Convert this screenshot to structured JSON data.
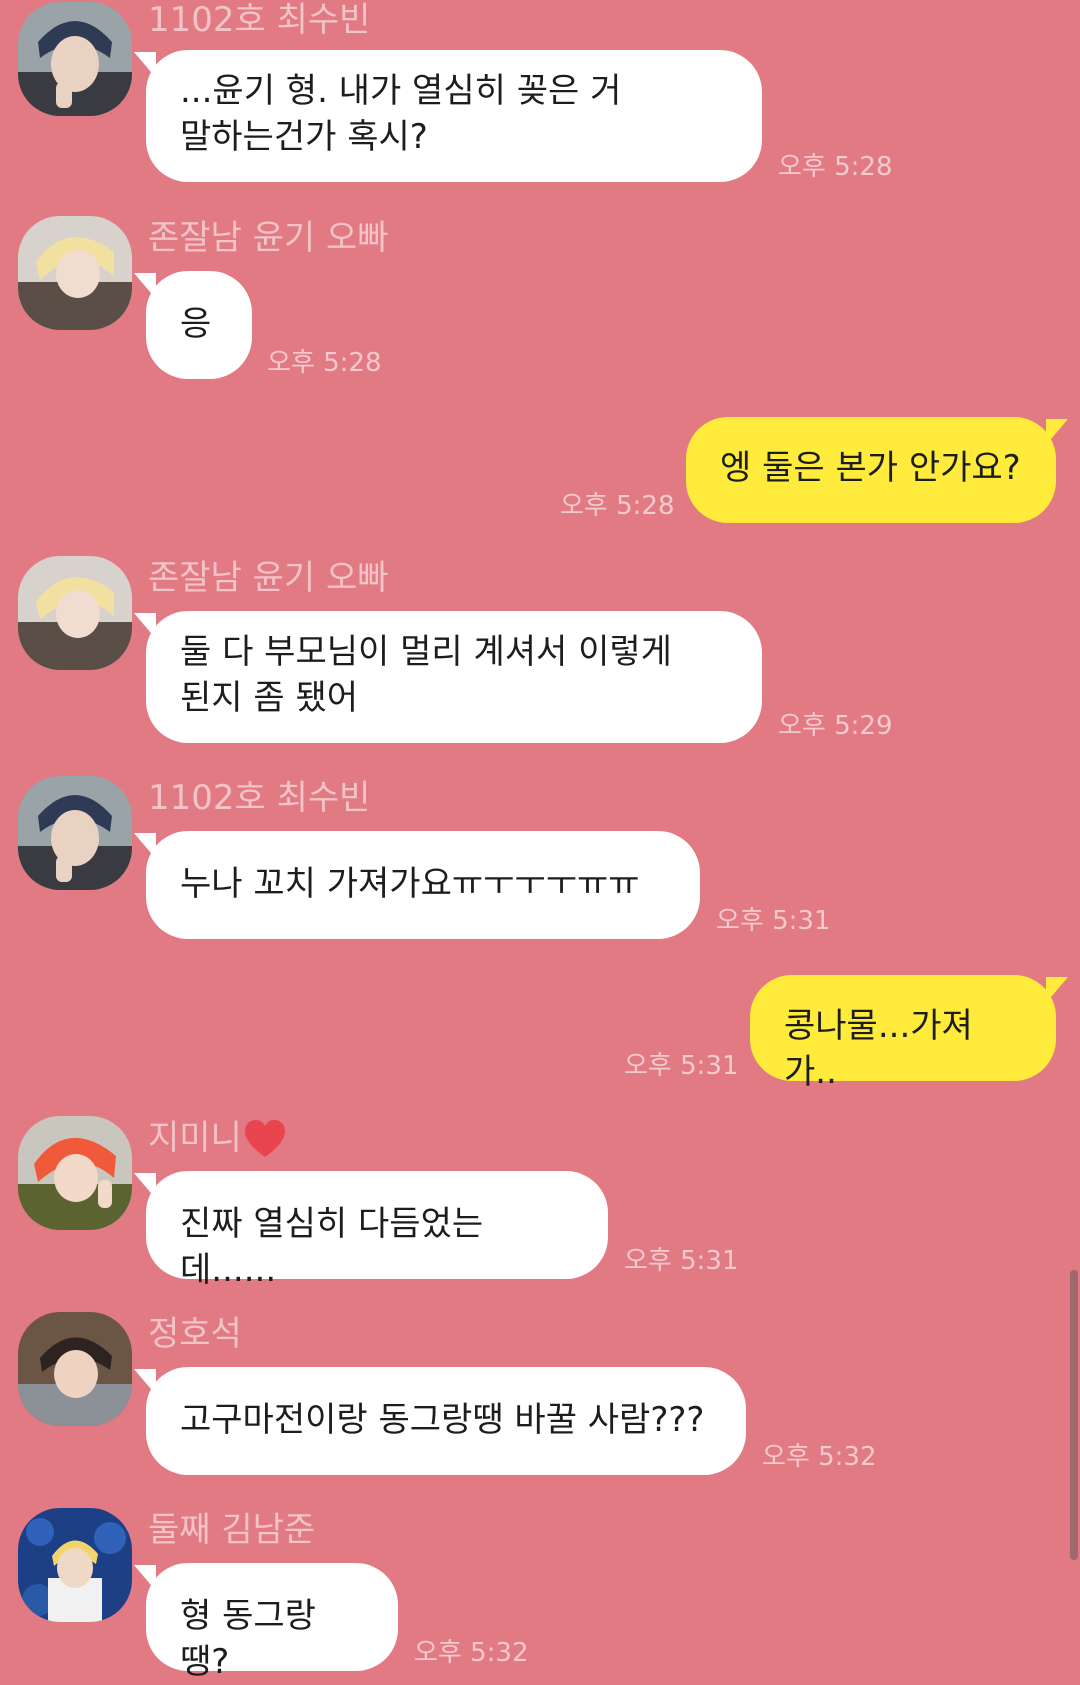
{
  "messages": [
    {
      "sender": "1102호 최수빈",
      "text": "...윤기 형. 내가 열심히 꽂은 거\n말하는건가 혹시?",
      "time": "오후 5:28",
      "direction": "incoming"
    },
    {
      "sender": "존잘남 윤기 오빠",
      "text": "응",
      "time": "오후 5:28",
      "direction": "incoming"
    },
    {
      "sender": "",
      "text": "엥 둘은 본가 안가요?",
      "time": "오후 5:28",
      "direction": "outgoing"
    },
    {
      "sender": "존잘남 윤기 오빠",
      "text": "둘 다 부모님이 멀리 계셔서 이렇게\n된지 좀 됐어",
      "time": "오후 5:29",
      "direction": "incoming"
    },
    {
      "sender": "1102호 최수빈",
      "text": "누나 꼬치 가져가요ㅠㅜㅜㅜㅠㅠ",
      "time": "오후 5:31",
      "direction": "incoming"
    },
    {
      "sender": "",
      "text": "콩나물...가져가..",
      "time": "오후 5:31",
      "direction": "outgoing"
    },
    {
      "sender": "지미니",
      "text": "진짜 열심히 다듬었는데......",
      "time": "오후 5:31",
      "direction": "incoming"
    },
    {
      "sender": "정호석",
      "text": "고구마전이랑 동그랑땡 바꿀 사람???",
      "time": "오후 5:32",
      "direction": "incoming"
    },
    {
      "sender": "둘째 김남준",
      "text": "형 동그랑땡?",
      "time": "오후 5:32",
      "direction": "incoming"
    }
  ],
  "colors": {
    "background": "#E27A83",
    "incoming_bubble": "#FFFFFF",
    "outgoing_bubble": "#FFEB3B",
    "heart": "#E8454F"
  },
  "icons": {
    "heart": "heart-icon"
  }
}
